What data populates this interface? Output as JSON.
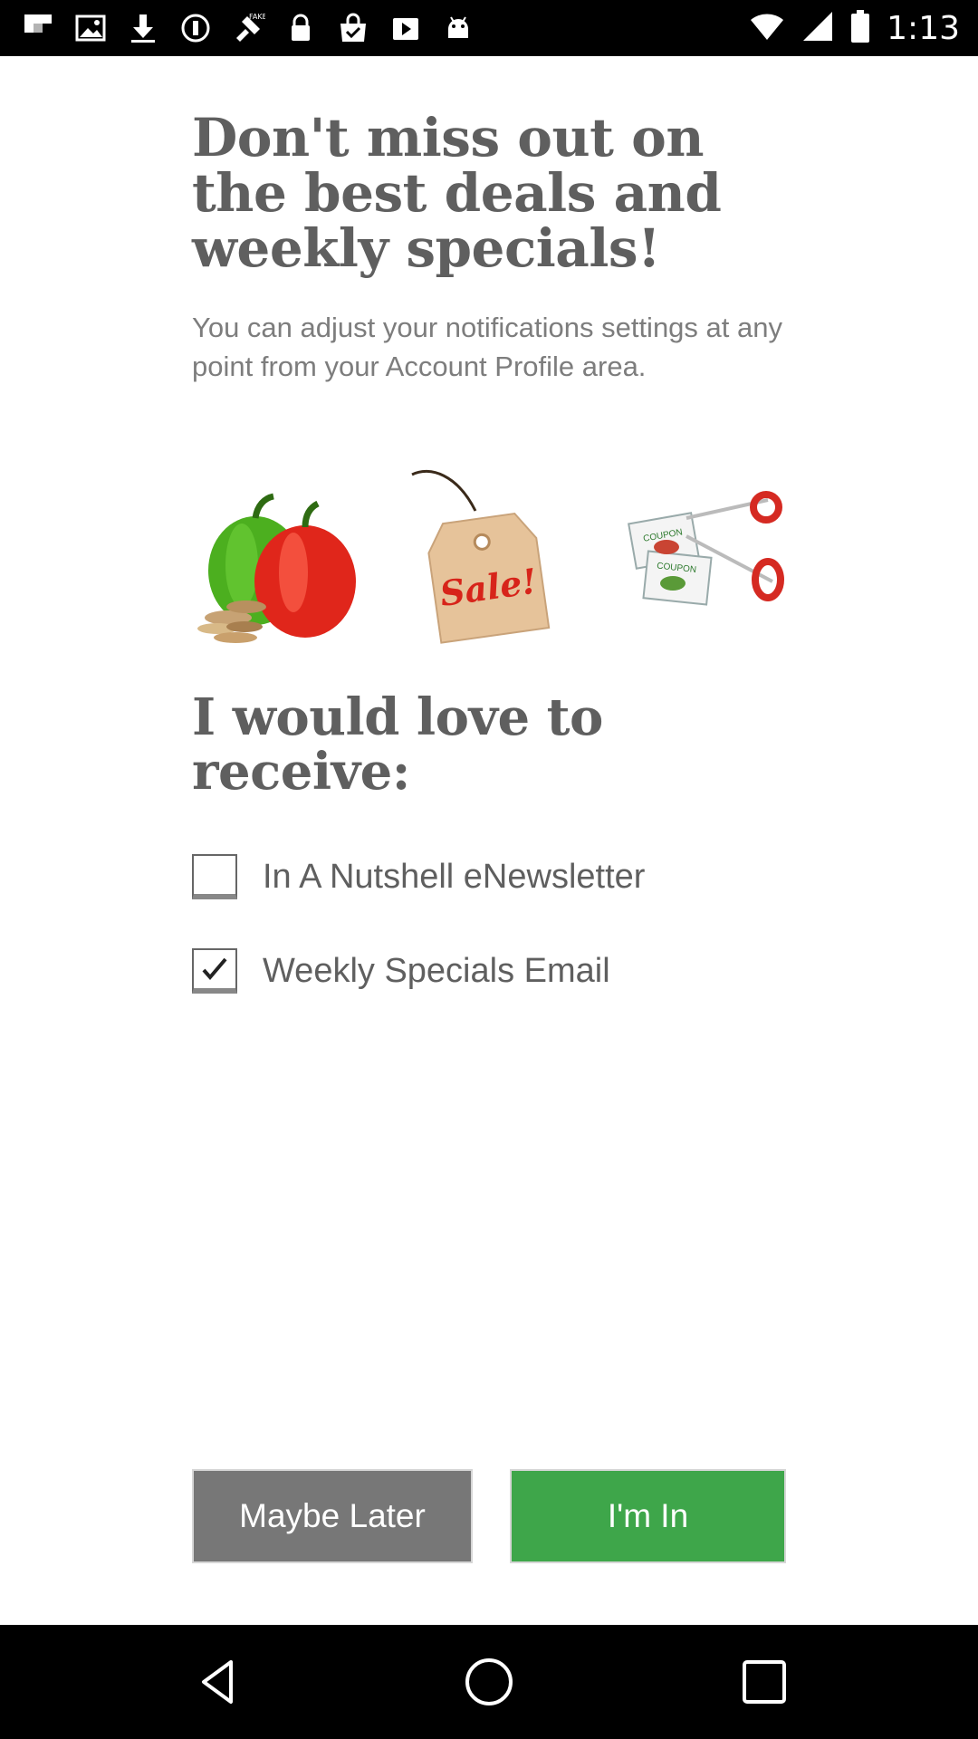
{
  "status_bar": {
    "time": "1:13",
    "icons": [
      "flipboard-icon",
      "image-icon",
      "download-icon",
      "blocked-icon",
      "fake-gps-icon",
      "lock-icon",
      "bag-check-icon",
      "play-store-icon",
      "android-icon",
      "wifi-icon",
      "signal-icon",
      "battery-icon"
    ]
  },
  "headline": "Don't miss out on the best deals and weekly specials!",
  "subtext": "You can adjust your notifications settings at any point from your Account Profile area.",
  "promo": {
    "sale_tag_text": "Sale!",
    "coupon_text": "COUPON"
  },
  "section_title": "I would love to receive:",
  "options": [
    {
      "label": "In A Nutshell eNewsletter",
      "checked": false
    },
    {
      "label": "Weekly Specials Email",
      "checked": true
    }
  ],
  "buttons": {
    "maybe_later": "Maybe Later",
    "im_in": "I'm In"
  },
  "colors": {
    "accent_green": "#3ea64a",
    "secondary_gray": "#777777",
    "text_gray": "#5f5f5f"
  }
}
